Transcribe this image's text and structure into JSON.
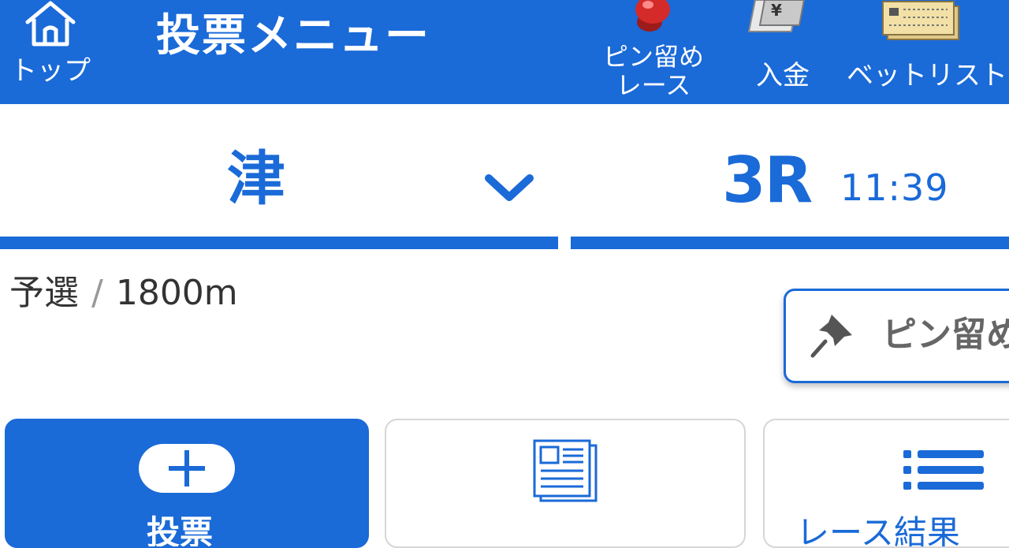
{
  "header": {
    "top_label": "トップ",
    "title": "投票メニュー",
    "pin_label_line1": "ピン留め",
    "pin_label_line2": "レース",
    "deposit_label": "入金",
    "yen_symbol": "¥",
    "betlist_label": "ベットリスト"
  },
  "selector": {
    "venue": "津",
    "race_number": "3R",
    "race_time": "11:39"
  },
  "race_info": {
    "grade": "予選",
    "separator": "/",
    "distance": "1800m"
  },
  "pin_race_button": {
    "label": "ピン留め"
  },
  "cards": {
    "vote_label": "投票",
    "list_label": "レース結果"
  },
  "colors": {
    "brand_blue": "#1a6ad8",
    "text": "#333333",
    "muted": "#666666",
    "border": "#d6d6d6"
  }
}
